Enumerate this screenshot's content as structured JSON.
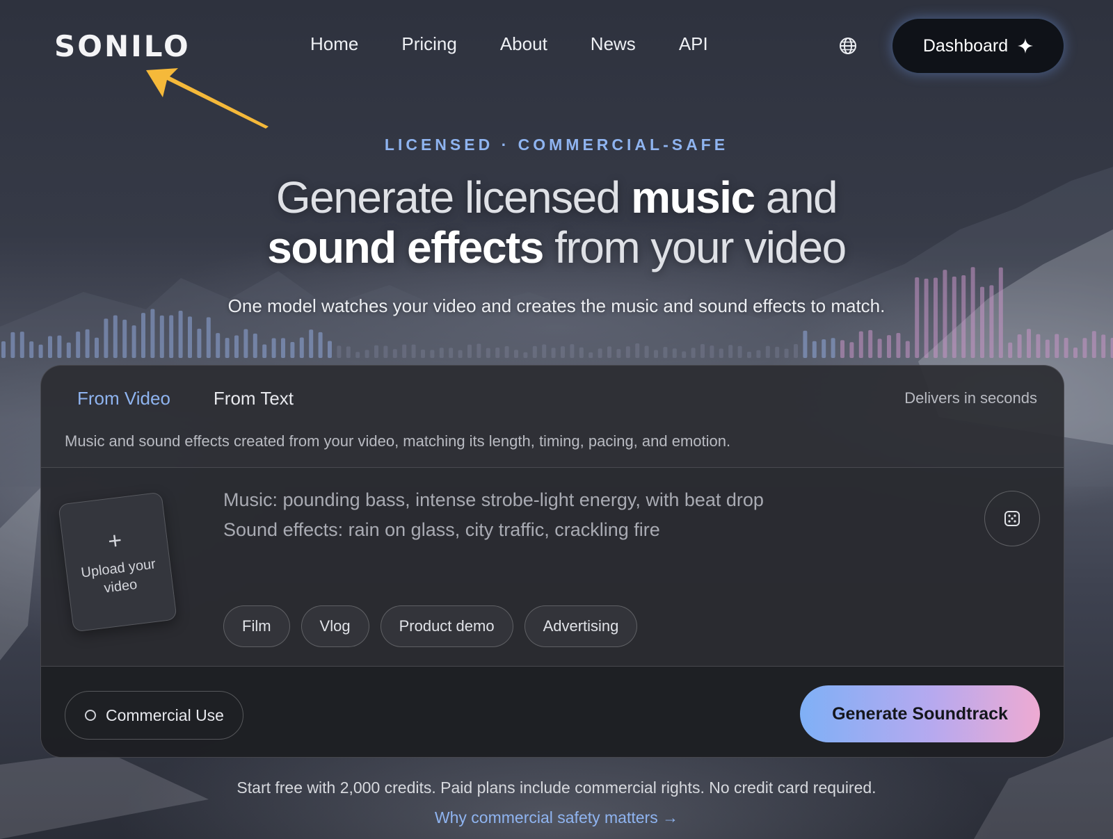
{
  "header": {
    "logo": "SONILO",
    "nav": [
      "Home",
      "Pricing",
      "About",
      "News",
      "API"
    ],
    "language_icon": "globe-icon",
    "dashboard_label": "Dashboard",
    "dashboard_icon": "sparkle-icon"
  },
  "annotation": {
    "arrow_color": "#f5b93a"
  },
  "hero": {
    "eyebrow": "LICENSED · COMMERCIAL-SAFE",
    "headline_line1": [
      {
        "text": "Generate licensed ",
        "weight": "dim"
      },
      {
        "text": "music",
        "weight": "bold"
      },
      {
        "text": " and",
        "weight": "dim"
      }
    ],
    "headline_line2": [
      {
        "text": "sound effects",
        "weight": "bold"
      },
      {
        "text": " from your video",
        "weight": "dim"
      }
    ],
    "subhead": "One model watches your video and creates the music and sound effects to match."
  },
  "card": {
    "tabs": [
      {
        "label": "From Video",
        "active": true
      },
      {
        "label": "From Text",
        "active": false
      }
    ],
    "delivers": "Delivers in seconds",
    "description": "Music and sound effects created from your video, matching its length, timing, pacing, and emotion.",
    "upload": {
      "plus": "+",
      "label": "Upload your video"
    },
    "prompt_line1": "Music: pounding bass, intense strobe-light energy, with beat drop",
    "prompt_line2": "Sound effects: rain on glass, city traffic, crackling fire",
    "dice_icon": "dice-icon",
    "chips": [
      "Film",
      "Vlog",
      "Product demo",
      "Advertising"
    ],
    "commercial_label": "Commercial Use",
    "commercial_checked": false,
    "generate_label": "Generate Soundtrack"
  },
  "footer": {
    "note": "Start free with 2,000 credits. Paid plans include commercial rights. No credit card required.",
    "link": "Why commercial safety matters →"
  },
  "colors": {
    "accent_blue": "#8fb4f0",
    "gradient_start": "#7fb0f6",
    "gradient_end": "#eeaad2"
  }
}
